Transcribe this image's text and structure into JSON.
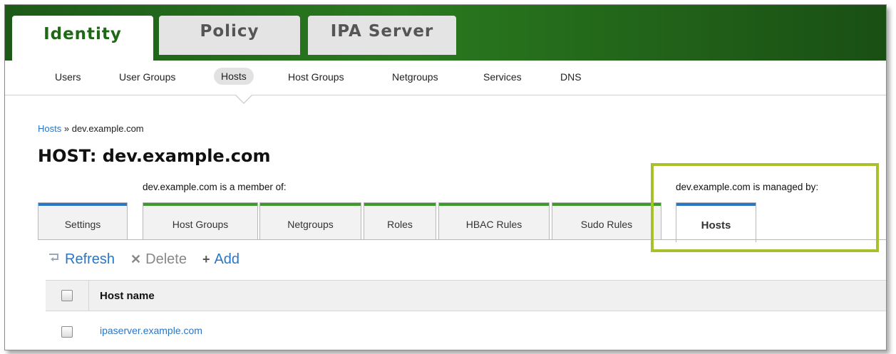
{
  "main_tabs": [
    {
      "label": "Identity",
      "active": true
    },
    {
      "label": "Policy",
      "active": false
    },
    {
      "label": "IPA Server",
      "active": false
    }
  ],
  "sub_nav": [
    {
      "label": "Users",
      "active": false
    },
    {
      "label": "User Groups",
      "active": false
    },
    {
      "label": "Hosts",
      "active": true
    },
    {
      "label": "Host Groups",
      "active": false
    },
    {
      "label": "Netgroups",
      "active": false
    },
    {
      "label": "Services",
      "active": false
    },
    {
      "label": "DNS",
      "active": false
    }
  ],
  "breadcrumb": {
    "link": "Hosts",
    "separator": "»",
    "current": "dev.example.com"
  },
  "page_title": "HOST: dev.example.com",
  "member_of_caption": "dev.example.com is a member of:",
  "managed_by_caption": "dev.example.com is managed by:",
  "facet_tabs": [
    {
      "label": "Settings",
      "color": "#2a76c6"
    },
    {
      "label": "Host Groups",
      "color": "#3d9a2a"
    },
    {
      "label": "Netgroups",
      "color": "#3d9a2a"
    },
    {
      "label": "Roles",
      "color": "#3d9a2a"
    },
    {
      "label": "HBAC Rules",
      "color": "#3d9a2a"
    },
    {
      "label": "Sudo Rules",
      "color": "#3d9a2a"
    },
    {
      "label": "Hosts",
      "color": "#2a76c6",
      "active": true
    }
  ],
  "actions": {
    "refresh": "Refresh",
    "delete": "Delete",
    "add": "Add"
  },
  "table": {
    "columns": [
      "Host name"
    ],
    "rows": [
      {
        "host_name": "ipaserver.example.com"
      }
    ]
  },
  "colors": {
    "brand_green": "#1e6a14",
    "link_blue": "#2a76c6",
    "highlight": "#a6c12a"
  }
}
